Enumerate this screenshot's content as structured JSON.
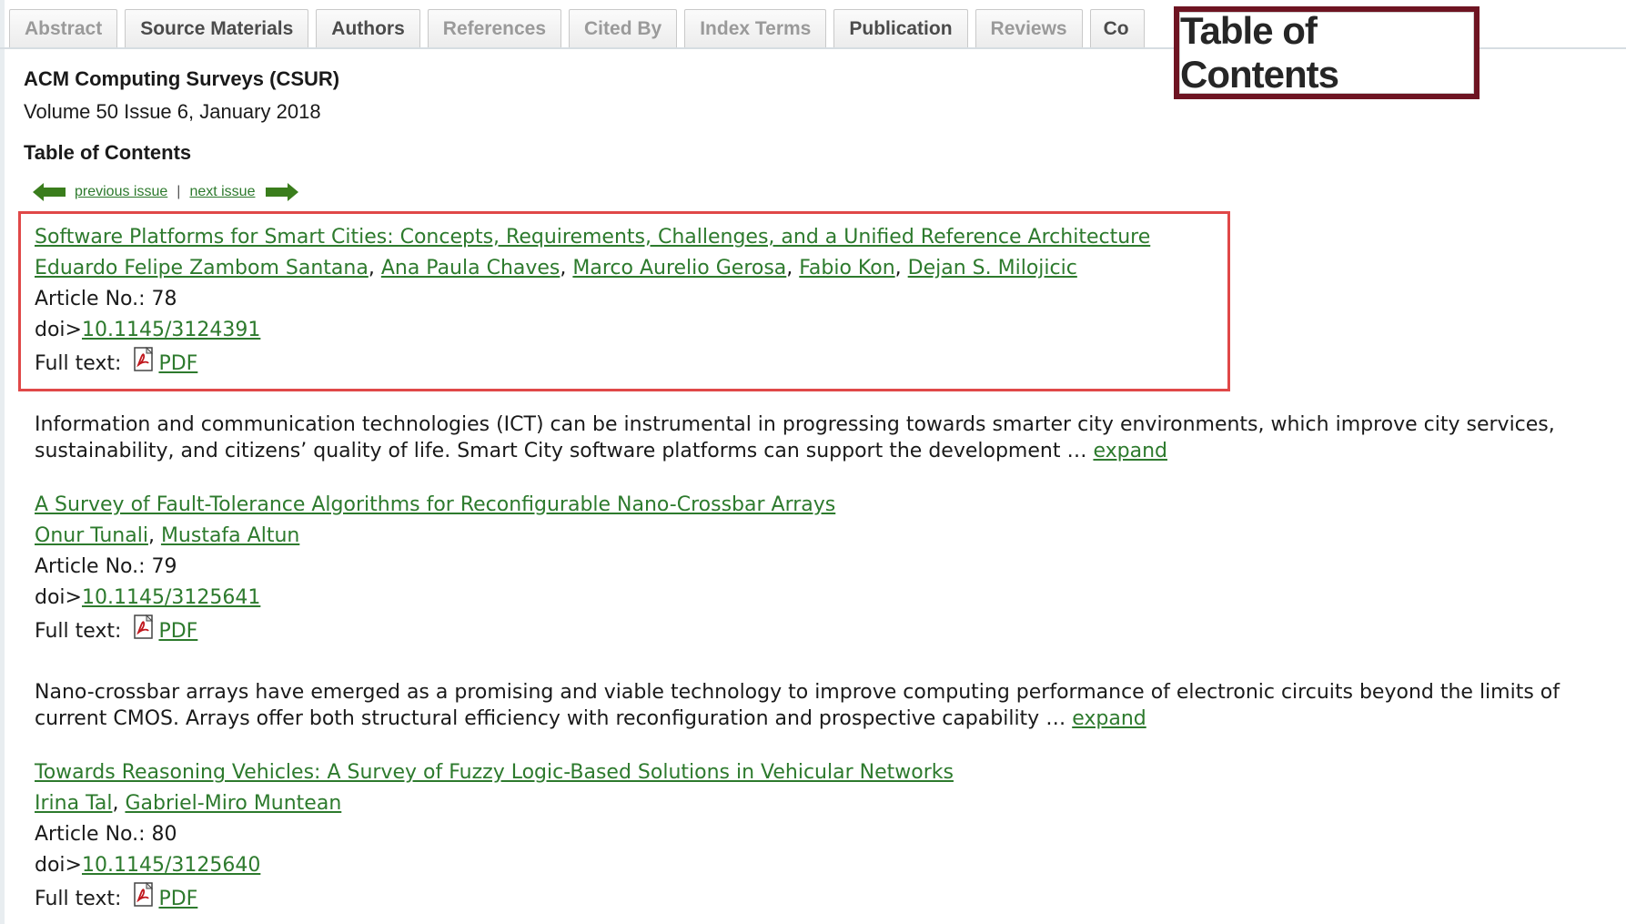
{
  "tabs": [
    {
      "label": "Abstract",
      "style": "muted"
    },
    {
      "label": "Source Materials",
      "style": "strong"
    },
    {
      "label": "Authors",
      "style": "strong"
    },
    {
      "label": "References",
      "style": "muted"
    },
    {
      "label": "Cited By",
      "style": "muted"
    },
    {
      "label": "Index Terms",
      "style": "muted"
    },
    {
      "label": "Publication",
      "style": "strong"
    },
    {
      "label": "Reviews",
      "style": "muted"
    },
    {
      "label": "Co",
      "style": "strong"
    }
  ],
  "callout": {
    "label": "Table of Contents"
  },
  "header": {
    "journal": "ACM Computing Surveys (CSUR)",
    "volume": "Volume 50 Issue 6, January 2018",
    "toc_heading": "Table of Contents"
  },
  "issue_nav": {
    "previous": "previous issue",
    "separator": "|",
    "next": "next issue"
  },
  "articles": [
    {
      "title": "Software Platforms for Smart Cities: Concepts, Requirements, Challenges, and a Unified Reference Architecture",
      "authors": [
        "Eduardo Felipe Zambom Santana",
        "Ana Paula Chaves",
        "Marco Aurelio Gerosa",
        "Fabio Kon",
        "Dejan S. Milojicic"
      ],
      "article_no_label": "Article No.: 78",
      "doi_prefix": "doi>",
      "doi": "10.1145/3124391",
      "fulltext_label": "Full text:",
      "pdf_label": "PDF",
      "abstract": "Information and communication technologies (ICT) can be instrumental in progressing towards smarter city environments, which improve city services, sustainability, and citizens’ quality of life. Smart City software platforms can support the development …",
      "expand_label": "expand"
    },
    {
      "title": "A Survey of Fault-Tolerance Algorithms for Reconfigurable Nano-Crossbar Arrays",
      "authors": [
        "Onur Tunali",
        "Mustafa Altun"
      ],
      "article_no_label": "Article No.: 79",
      "doi_prefix": "doi>",
      "doi": "10.1145/3125641",
      "fulltext_label": "Full text:",
      "pdf_label": "PDF",
      "abstract": "Nano-crossbar arrays have emerged as a promising and viable technology to improve computing performance of electronic circuits beyond the limits of current CMOS. Arrays offer both structural efficiency with reconfiguration and prospective capability …",
      "expand_label": "expand"
    },
    {
      "title": "Towards Reasoning Vehicles: A Survey of Fuzzy Logic-Based Solutions in Vehicular Networks",
      "authors": [
        "Irina Tal",
        "Gabriel-Miro Muntean"
      ],
      "article_no_label": "Article No.: 80",
      "doi_prefix": "doi>",
      "doi": "10.1145/3125640",
      "fulltext_label": "Full text:",
      "pdf_label": "PDF"
    }
  ],
  "colors": {
    "link": "#2d7a2d",
    "highlight": "#e04848",
    "callout_border": "#6e1422",
    "arrow": "#3a7d1c"
  }
}
